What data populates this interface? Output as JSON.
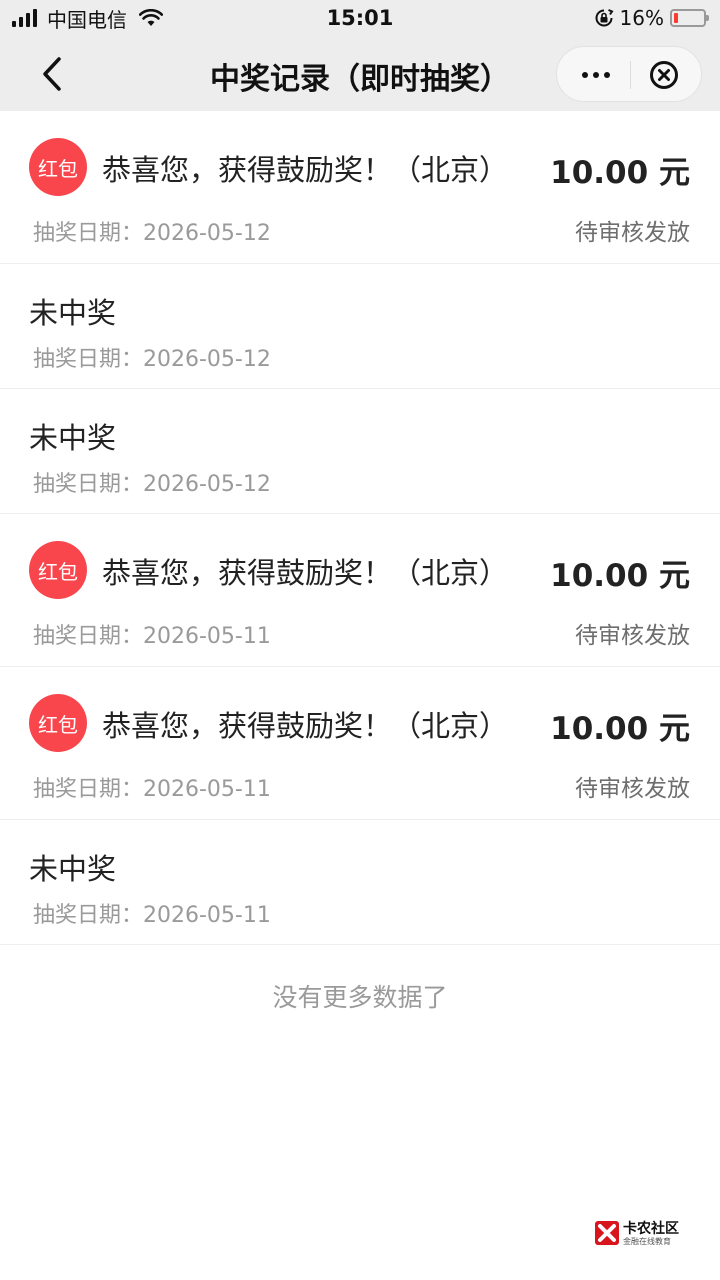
{
  "status_bar": {
    "carrier": "中国电信",
    "time": "15:01",
    "battery_percent": "16%",
    "battery_level": 0.16,
    "battery_color": "#ff3b30",
    "icons": [
      "signal-icon",
      "wifi-icon",
      "orientation-lock-icon",
      "battery-icon"
    ]
  },
  "nav": {
    "title": "中奖记录（即时抽奖）",
    "back_icon": "chevron-left-icon",
    "more_icon": "more-dots-icon",
    "close_icon": "close-circle-icon"
  },
  "colors": {
    "badge": "#f9464d",
    "background": "#ffffff",
    "header": "#ededed"
  },
  "records": [
    {
      "won": true,
      "badge": "红包",
      "title": "恭喜您，获得鼓励奖！（北京）",
      "amount": "10.00 元",
      "date": "抽奖日期：2026-05-12",
      "status": "待审核发放"
    },
    {
      "won": false,
      "title": "未中奖",
      "date": "抽奖日期：2026-05-12"
    },
    {
      "won": false,
      "title": "未中奖",
      "date": "抽奖日期：2026-05-12"
    },
    {
      "won": true,
      "badge": "红包",
      "title": "恭喜您，获得鼓励奖！（北京）",
      "amount": "10.00 元",
      "date": "抽奖日期：2026-05-11",
      "status": "待审核发放"
    },
    {
      "won": true,
      "badge": "红包",
      "title": "恭喜您，获得鼓励奖！（北京）",
      "amount": "10.00 元",
      "date": "抽奖日期：2026-05-11",
      "status": "待审核发放"
    },
    {
      "won": false,
      "title": "未中奖",
      "date": "抽奖日期：2026-05-11"
    }
  ],
  "footer": {
    "no_more": "没有更多数据了"
  },
  "watermark": {
    "name": "卡农社区",
    "tagline": "金融在线教育"
  }
}
